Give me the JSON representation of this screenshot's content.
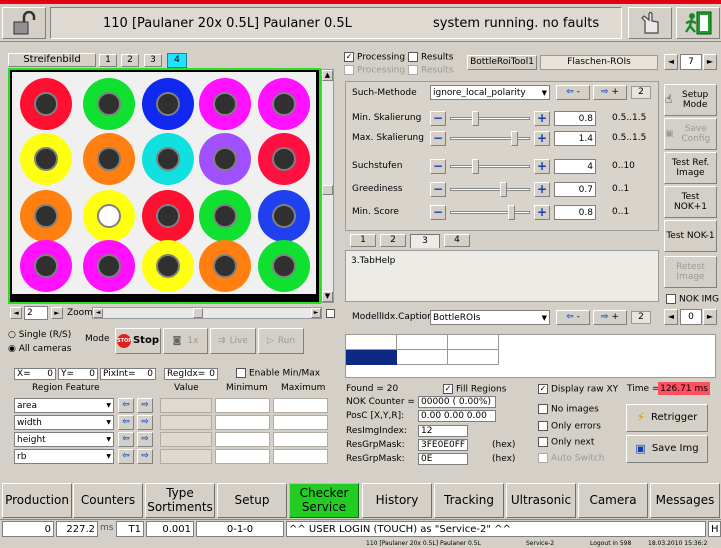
{
  "header": {
    "title": "110 [Paulaner 20x 0.5L] Paulaner 0.5L",
    "status": "system running. no faults"
  },
  "image_panel": {
    "tabs": [
      "Streifenbild",
      "1",
      "2",
      "3",
      "4"
    ],
    "zoom_value": "2",
    "zoom_label": "Zoom"
  },
  "mode": {
    "single_label": "Single (R/S)",
    "all_label": "All cameras",
    "mode_label": "Mode",
    "stop_label": "Stop",
    "onex_label": "1x",
    "live_label": "Live",
    "run_label": "Run"
  },
  "coords": {
    "x_label": "X=",
    "x_value": "0",
    "y_label": "Y=",
    "y_value": "0",
    "pixint_label": "PixInt=",
    "pixint_value": "0",
    "regidx_label": "RegIdx=",
    "regidx_value": "0",
    "enable_label": "Enable Min/Max"
  },
  "region_table": {
    "headers": [
      "Region Feature",
      "Value",
      "Minimum",
      "Maximum"
    ],
    "rows": [
      "area",
      "width",
      "height",
      "rb"
    ]
  },
  "processing": {
    "processing_label": "Processing",
    "results_label": "Results",
    "tool_label": "BottleRoiTool1",
    "roi_label": "Flaschen-ROIs",
    "page_value": "7"
  },
  "params": {
    "method_label": "Such-Methode",
    "method_value": "ignore_local_polarity",
    "method_page": "2",
    "rows": [
      {
        "label": "Min. Skalierung",
        "value": "0.8",
        "range": "0.5..1.5"
      },
      {
        "label": "Max. Skalierung",
        "value": "1.4",
        "range": "0.5..1.5"
      },
      {
        "label": "Suchstufen",
        "value": "4",
        "range": "0..10"
      },
      {
        "label": "Greediness",
        "value": "0.7",
        "range": "0..1"
      },
      {
        "label": "Min. Score",
        "value": "0.8",
        "range": "0..1"
      }
    ],
    "subtabs": [
      "1",
      "2",
      "3",
      "4"
    ],
    "help_text": "3.TabHelp"
  },
  "side_buttons": {
    "setup_mode": "Setup Mode",
    "save_config": "Save Config",
    "test_ref": "Test Ref. Image",
    "test_nok_plus": "Test NOK+1",
    "test_nok_minus": "Test NOK-1",
    "retest": "Retest Image",
    "nok_img": "NOK IMG",
    "side_page": "0"
  },
  "model": {
    "caption_label": "ModellIdx.Caption",
    "caption_value": "BottleROIs",
    "page": "2"
  },
  "results": {
    "found_label": "Found =",
    "found_value": "20",
    "fill_regions": "Fill Regions",
    "display_raw": "Display raw XY",
    "time_label": "Time =",
    "time_value": "126.71 ms",
    "nok_label": "NOK Counter =",
    "nok_value": "00000  ( 0.00%)",
    "posc_label": "PosC [X,Y,R]:",
    "posc_value": "0.00   0.00   0.00",
    "resimg_label": "ResImgIndex:",
    "resimg_value": "12",
    "resgrp_label": "ResGrpMask:",
    "resgrp_value": "3FE0E0FF",
    "resgrp_hex": "(hex)",
    "resgrp2_label": "ResGrpMask:",
    "resgrp2_value": "0E",
    "resgrp2_hex": "(hex)",
    "no_images": "No images",
    "only_errors": "Only errors",
    "only_next": "Only next",
    "auto_switch": "Auto Switch",
    "retrigger": "Retrigger",
    "save_img": "Save Img"
  },
  "nav_tabs": [
    "Production",
    "Counters",
    "Type Sortiments",
    "Setup",
    "Checker Service",
    "History",
    "Tracking",
    "Ultrasonic",
    "Camera",
    "Messages"
  ],
  "status_bar": {
    "v1": "0",
    "v2": "227.2",
    "unit": "ms",
    "t1": "T1",
    "v3": "0.001",
    "v4": "0-1-0",
    "message": "^^ USER LOGIN (TOUCH) as \"Service-2\" ^^",
    "end": "H"
  },
  "footer": {
    "product": "110 [Paulaner 20x 0.5L] Paulaner 0.5L",
    "user": "Service-2",
    "logout": "Logout in 598",
    "datetime": "18.03.2010 15:36:2"
  },
  "colors": {
    "accent_red": "#e00010",
    "active_tab_green": "#22cc22",
    "active_subtab_cyan": "#22e0ff",
    "time_bg": "#ff5060"
  }
}
